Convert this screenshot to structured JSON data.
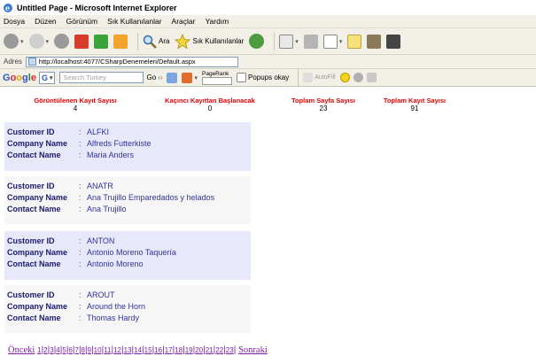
{
  "window": {
    "title": "Untitled Page - Microsoft Internet Explorer"
  },
  "menu": [
    "Dosya",
    "Düzen",
    "Görünüm",
    "Sık Kullanılanlar",
    "Araçlar",
    "Yardım"
  ],
  "toolbar": {
    "search_label": "Ara",
    "favorites_label": "Sık Kullanılanlar"
  },
  "address": {
    "label": "Adres",
    "url": "http://localhost:4077/CSharpDenemeleri/Default.aspx"
  },
  "google_bar": {
    "go_label": "Go",
    "search_placeholder": "Search Turkey",
    "pagerank_label": "PageRank",
    "popups_label": "Popups okay",
    "autofill_label": "AutoFill"
  },
  "stats": [
    {
      "label": "Görüntülenen Kayıt Sayısı",
      "value": "4"
    },
    {
      "label": "Kaçıncı Kayıttan Başlanacak",
      "value": "0"
    },
    {
      "label": "Toplam Sayfa Sayısı",
      "value": "23"
    },
    {
      "label": "Toplam Kayıt Sayısı",
      "value": "91"
    }
  ],
  "field_labels": {
    "customer_id": "Customer ID",
    "company_name": "Company Name",
    "contact_name": "Contact Name",
    "colon": ":"
  },
  "records": [
    {
      "customer_id": "ALFKI",
      "company_name": "Alfreds Futterkiste",
      "contact_name": "Maria Anders"
    },
    {
      "customer_id": "ANATR",
      "company_name": "Ana Trujillo Emparedados y helados",
      "contact_name": "Ana Trujillo"
    },
    {
      "customer_id": "ANTON",
      "company_name": "Antonio Moreno Taquería",
      "contact_name": "Antonio Moreno"
    },
    {
      "customer_id": "AROUT",
      "company_name": "Around the Horn",
      "contact_name": "Thomas Hardy"
    }
  ],
  "pager": {
    "prev_label": "Önceki",
    "next_label": "Sonraki",
    "pages": [
      "1",
      "2",
      "3",
      "4",
      "5",
      "6",
      "7",
      "8",
      "9",
      "10",
      "11",
      "12",
      "13",
      "14",
      "15",
      "16",
      "17",
      "18",
      "19",
      "20",
      "21",
      "22",
      "23"
    ]
  }
}
